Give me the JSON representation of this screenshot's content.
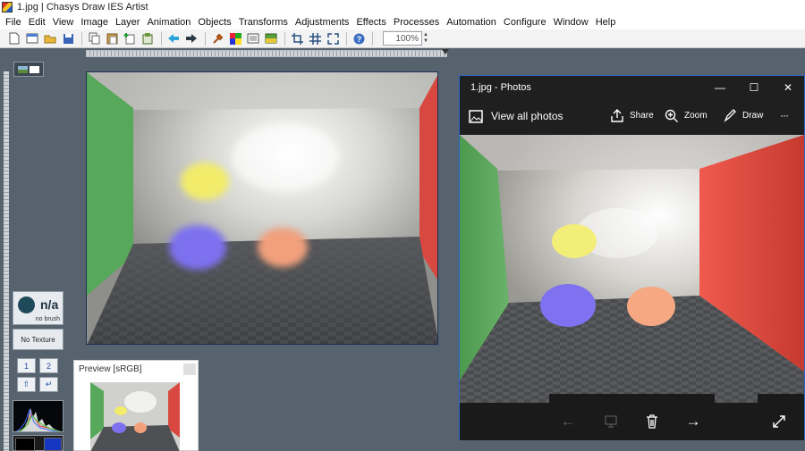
{
  "window": {
    "title": "1.jpg | Chasys Draw IES Artist"
  },
  "menu": [
    "File",
    "Edit",
    "View",
    "Image",
    "Layer",
    "Animation",
    "Objects",
    "Transforms",
    "Adjustments",
    "Effects",
    "Processes",
    "Automation",
    "Configure",
    "Window",
    "Help"
  ],
  "toolbar": {
    "buttons": [
      "new-icon",
      "new-window-icon",
      "open-icon",
      "save-icon",
      "copy-icon",
      "paste-icon",
      "paste-new-icon",
      "paste-layer-icon",
      "undo-icon",
      "redo-icon",
      "eyedropper-icon",
      "color-icon",
      "layers-icon",
      "adjust-icon",
      "crop-icon",
      "grid-icon",
      "fullscreen-icon",
      "help-icon"
    ],
    "zoom": "100%"
  },
  "brush": {
    "name": "n/a",
    "sub": "no brush"
  },
  "texture": {
    "label": "No Texture"
  },
  "keys": [
    "1",
    "2"
  ],
  "preview": {
    "title": "Preview [sRGB]"
  },
  "photos": {
    "title": "1.jpg - Photos",
    "view_all": "View all photos",
    "actions": [
      "Share",
      "Zoom",
      "Draw"
    ],
    "more": "···"
  },
  "colors": {
    "canvas_border": "#1b2f52",
    "photos_border": "#2b64c8",
    "app_bg": "#56636f"
  }
}
